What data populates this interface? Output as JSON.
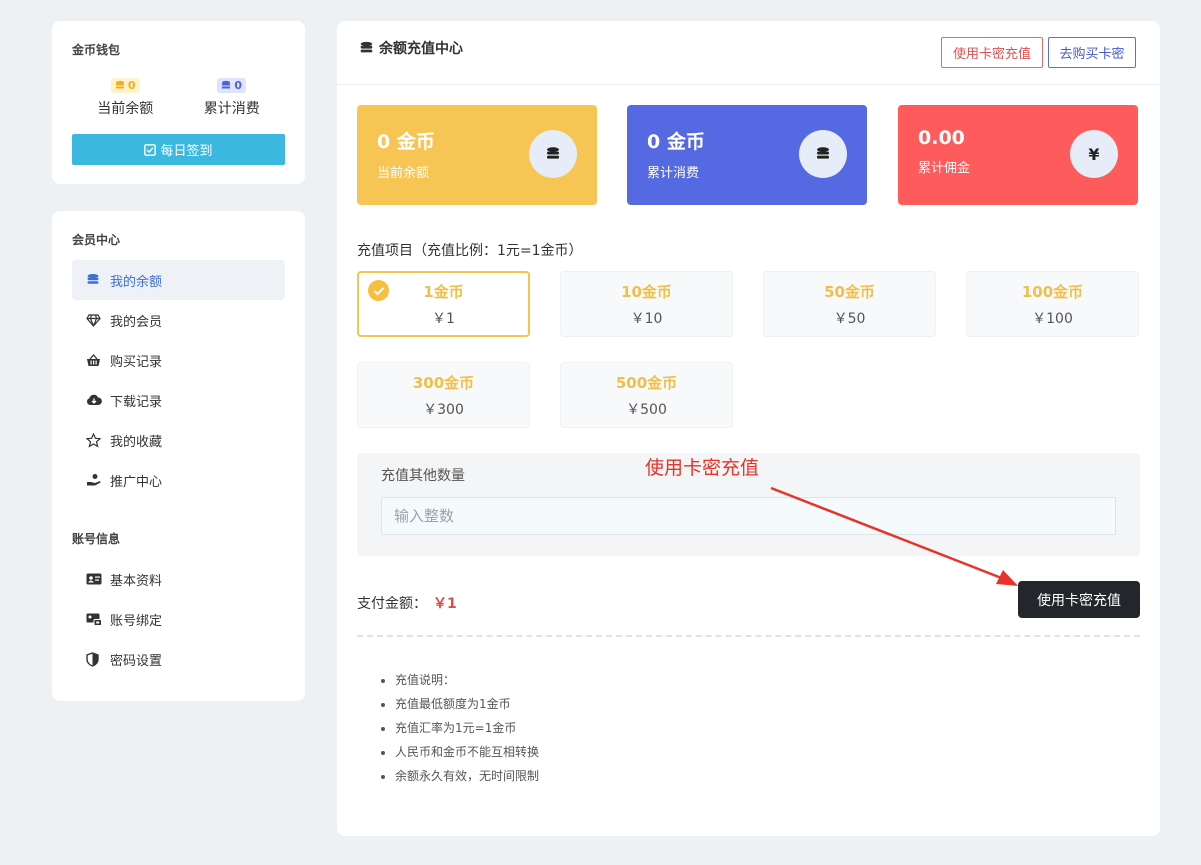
{
  "wallet": {
    "title": "金币钱包",
    "balance_badge": "0",
    "balance_label": "当前余额",
    "spent_badge": "0",
    "spent_label": "累计消费",
    "checkin_label": "每日签到"
  },
  "member": {
    "title": "会员中心",
    "items": [
      {
        "label": "我的余额",
        "icon": "coins-icon"
      },
      {
        "label": "我的会员",
        "icon": "diamond-icon"
      },
      {
        "label": "购买记录",
        "icon": "basket-icon"
      },
      {
        "label": "下载记录",
        "icon": "cloud-download-icon"
      },
      {
        "label": "我的收藏",
        "icon": "star-icon"
      },
      {
        "label": "推广中心",
        "icon": "hand-coin-icon"
      }
    ],
    "account_title": "账号信息",
    "account_items": [
      {
        "label": "基本资料",
        "icon": "id-card-icon"
      },
      {
        "label": "账号绑定",
        "icon": "account-bind-icon"
      },
      {
        "label": "密码设置",
        "icon": "shield-icon"
      }
    ]
  },
  "main": {
    "title": "余额充值中心",
    "card_recharge_btn": "使用卡密充值",
    "buy_card_btn": "去购买卡密",
    "stats": [
      {
        "value": "0 金币",
        "label": "当前余额",
        "color": "#f7c553"
      },
      {
        "value": "0 金币",
        "label": "累计消费",
        "color": "#5469e2"
      },
      {
        "value": "0.00",
        "label": "累计佣金",
        "color": "#fe5c5c",
        "icon_glyph": "¥"
      }
    ],
    "recharge_label": "充值项目（充值比例：1元=1金币）",
    "options": [
      {
        "coins": "1金币",
        "price": "￥1",
        "selected": true
      },
      {
        "coins": "10金币",
        "price": "￥10"
      },
      {
        "coins": "50金币",
        "price": "￥50"
      },
      {
        "coins": "100金币",
        "price": "￥100"
      },
      {
        "coins": "300金币",
        "price": "￥300"
      },
      {
        "coins": "500金币",
        "price": "￥500"
      }
    ],
    "other_label": "充值其他数量",
    "other_placeholder": "输入整数",
    "annotation": "使用卡密充值",
    "pay_label": "支付金额：",
    "pay_amount": "￥1",
    "submit_label": "使用卡密充值",
    "notes": [
      "充值说明：",
      "充值最低额度为1金币",
      "充值汇率为1元=1金币",
      "人民币和金币不能互相转换",
      "余额永久有效，无时间限制"
    ]
  },
  "colors": {
    "accent_yellow": "#f7c553",
    "accent_blue": "#5469e2",
    "accent_red": "#fe5c5c",
    "checkin_blue": "#3bb8e0",
    "annotation_red": "#e8322a"
  }
}
